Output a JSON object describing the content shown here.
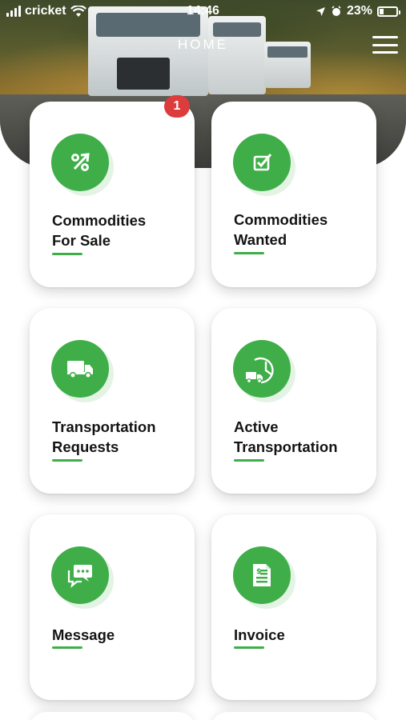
{
  "status_bar": {
    "carrier": "cricket",
    "time": "14:46",
    "battery": "23%"
  },
  "header": {
    "title": "HOME"
  },
  "cards": [
    {
      "label": "Commodities For Sale",
      "line1": "Commodities",
      "line2": "For Sale",
      "icon": "percent-arrow-icon",
      "badge": "1"
    },
    {
      "label": "Commodities Wanted",
      "line1": "Commodities",
      "line2": "Wanted",
      "icon": "checkbox-icon"
    },
    {
      "label": "Transportation Requests",
      "line1": "Transportation",
      "line2": "Requests",
      "icon": "truck-icon"
    },
    {
      "label": "Active Transportation",
      "line1": "Active",
      "line2": "Transportation",
      "icon": "truck-clock-icon"
    },
    {
      "label": "Message",
      "line1": "Message",
      "line2": "",
      "icon": "chat-icon"
    },
    {
      "label": "Invoice",
      "line1": "Invoice",
      "line2": "",
      "icon": "invoice-icon"
    }
  ],
  "colors": {
    "accent": "#3fae49",
    "badge": "#dc3c3c"
  }
}
